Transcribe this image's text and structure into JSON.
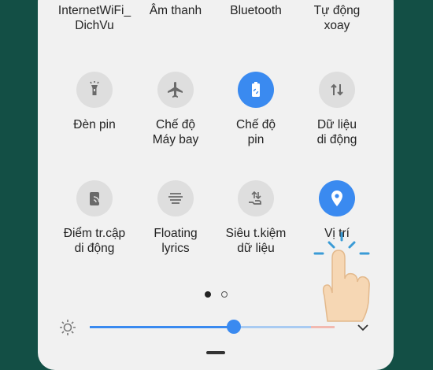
{
  "top_row": [
    "InternetWiFi_\nDichVu",
    "Âm thanh",
    "Bluetooth",
    "Tự động\nxoay"
  ],
  "tiles_row1": [
    {
      "label": "Đèn pin",
      "icon": "flashlight-icon",
      "active": false
    },
    {
      "label": "Chế độ\nMáy bay",
      "icon": "airplane-icon",
      "active": false
    },
    {
      "label": "Chế độ\npin",
      "icon": "battery-saver-icon",
      "active": true
    },
    {
      "label": "Dữ liệu\ndi động",
      "icon": "mobile-data-icon",
      "active": false
    }
  ],
  "tiles_row2": [
    {
      "label": "Điểm tr.cập\ndi động",
      "icon": "hotspot-icon",
      "active": false
    },
    {
      "label": "Floating\nlyrics",
      "icon": "floating-lyrics-icon",
      "active": false
    },
    {
      "label": "Siêu t.kiệm\ndữ liệu",
      "icon": "data-saver-icon",
      "active": false
    },
    {
      "label": "Vị trí",
      "icon": "location-icon",
      "active": true
    }
  ],
  "pagination": {
    "pages": 2,
    "current": 1
  },
  "brightness": {
    "level": 0.6
  },
  "colors": {
    "accent": "#3a8af0",
    "background": "#134f45",
    "panel": "#f1f1f1"
  }
}
